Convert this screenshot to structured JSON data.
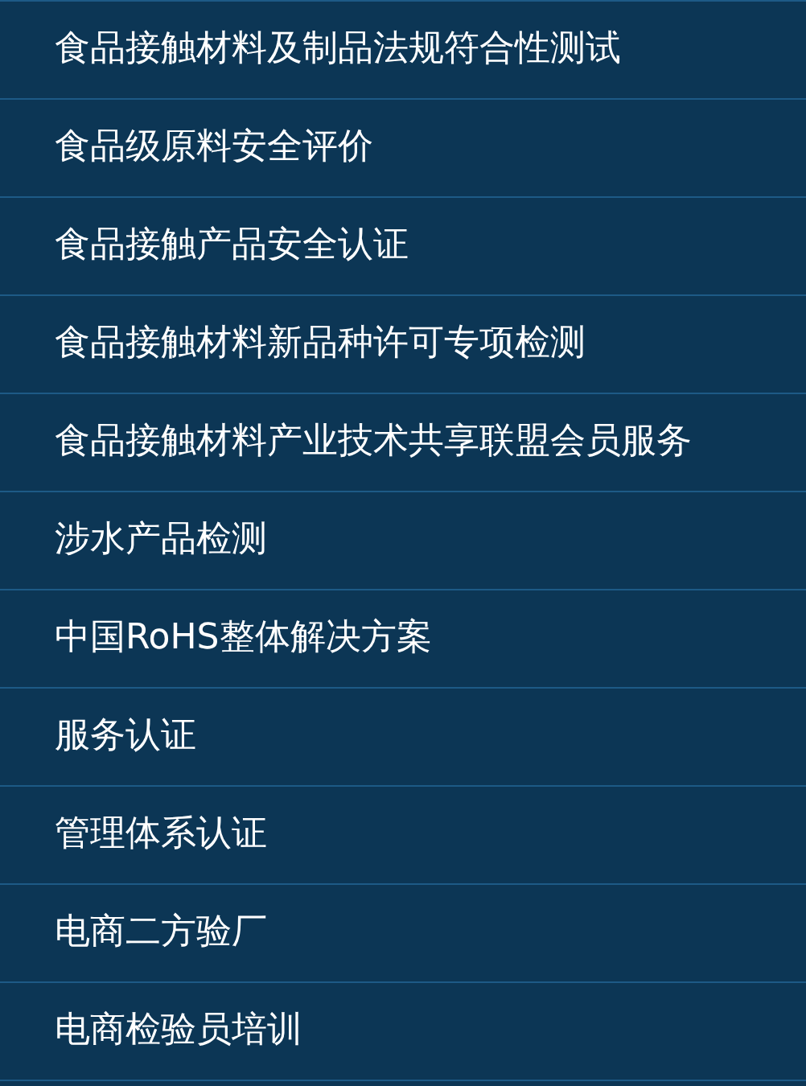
{
  "menu": {
    "items": [
      {
        "label": "食品接触材料及制品法规符合性测试"
      },
      {
        "label": "食品级原料安全评价"
      },
      {
        "label": "食品接触产品安全认证"
      },
      {
        "label": "食品接触材料新品种许可专项检测"
      },
      {
        "label": "食品接触材料产业技术共享联盟会员服务"
      },
      {
        "label": "涉水产品检测"
      },
      {
        "label": "中国RoHS整体解决方案"
      },
      {
        "label": "服务认证"
      },
      {
        "label": "管理体系认证"
      },
      {
        "label": "电商二方验厂"
      },
      {
        "label": "电商检验员培训"
      }
    ]
  }
}
